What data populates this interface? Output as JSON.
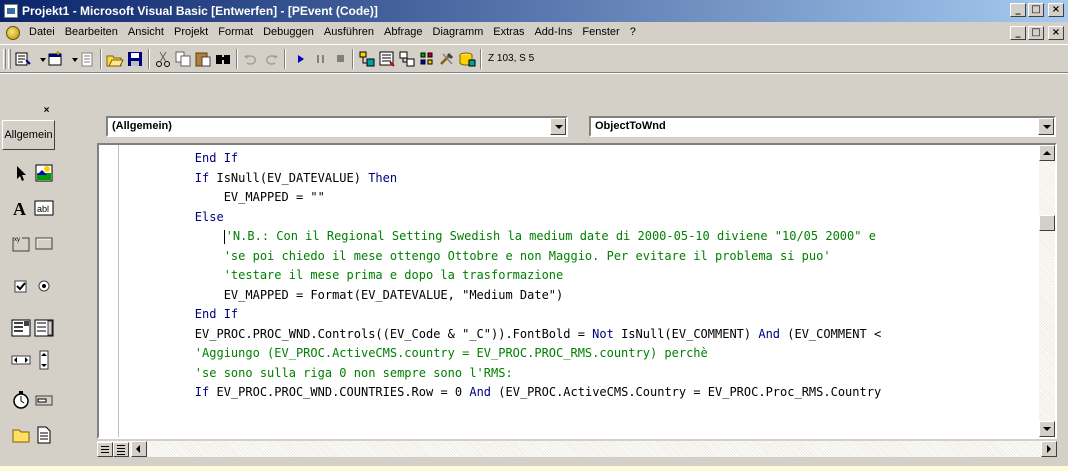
{
  "window": {
    "title": "Projekt1 - Microsoft Visual Basic [Entwerfen] - [PEvent (Code)]",
    "minimize": "_",
    "maximize": "□",
    "close": "×"
  },
  "menu": {
    "items": [
      "Datei",
      "Bearbeiten",
      "Ansicht",
      "Projekt",
      "Format",
      "Debuggen",
      "Ausführen",
      "Abfrage",
      "Diagramm",
      "Extras",
      "Add-Ins",
      "Fenster",
      "?"
    ],
    "restore": "_",
    "restore2": "□",
    "close": "×"
  },
  "toolbar": {
    "position": "Z 103, S 5",
    "icons": [
      "add-project-icon",
      "add-form-icon",
      "menu-editor-icon",
      "open-icon",
      "save-icon",
      "cut-icon",
      "copy-icon",
      "paste-icon",
      "find-icon",
      "undo-icon",
      "redo-icon",
      "run-icon",
      "break-icon",
      "stop-icon",
      "project-explorer-icon",
      "properties-icon",
      "form-layout-icon",
      "object-browser-icon",
      "toolbox-icon",
      "data-view-icon"
    ]
  },
  "toolbox": {
    "close": "×",
    "tab": "Allgemein",
    "tools": [
      "pointer-icon",
      "picturebox-icon",
      "label-icon",
      "textbox-icon",
      "frame-icon",
      "commandbutton-icon",
      "checkbox-icon",
      "optionbutton-icon",
      "combobox-icon",
      "listbox-icon",
      "hscrollbar-icon",
      "vscrollbar-icon",
      "timer-icon",
      "drivelistbox-icon",
      "dirlistbox-icon",
      "filelistbox-icon"
    ]
  },
  "code_window": {
    "object_combo": "(Allgemein)",
    "procedure_combo": "ObjectToWnd",
    "lines": [
      [
        {
          "t": "        End If",
          "c": "kw"
        }
      ],
      [
        {
          "t": "        If ",
          "c": "kw"
        },
        {
          "t": "IsNull(EV_DATEVALUE) ",
          "c": ""
        },
        {
          "t": "Then",
          "c": "kw"
        }
      ],
      [
        {
          "t": "            EV_MAPPED = \"\"",
          "c": ""
        }
      ],
      [
        {
          "t": "        Else",
          "c": "kw"
        }
      ],
      [
        {
          "t": "            'N.B.: Con il Regional Setting Swedish la medium date di 2000-05-10 diviene \"10/05 2000\" e",
          "c": "cm",
          "cursor": true
        }
      ],
      [
        {
          "t": "            'se poi chiedo il mese ottengo Ottobre e non Maggio. Per evitare il problema si puo'",
          "c": "cm"
        }
      ],
      [
        {
          "t": "            'testare il mese prima e dopo la trasformazione",
          "c": "cm"
        }
      ],
      [
        {
          "t": "            EV_MAPPED = Format(EV_DATEVALUE, \"Medium Date\")",
          "c": ""
        }
      ],
      [
        {
          "t": "        End If",
          "c": "kw"
        }
      ],
      [
        {
          "t": "        EV_PROC.PROC_WND.Controls((EV_Code & \"_C\")).FontBold = ",
          "c": ""
        },
        {
          "t": "Not",
          "c": "kw"
        },
        {
          "t": " IsNull(EV_COMMENT) ",
          "c": ""
        },
        {
          "t": "And",
          "c": "kw"
        },
        {
          "t": " (EV_COMMENT <",
          "c": ""
        }
      ],
      [
        {
          "t": "        'Aggiungo (EV_PROC.ActiveCMS.country = EV_PROC.PROC_RMS.country) perchè",
          "c": "cm"
        }
      ],
      [
        {
          "t": "        'se sono sulla riga 0 non sempre sono l'RMS:",
          "c": "cm"
        }
      ],
      [
        {
          "t": "        If ",
          "c": "kw"
        },
        {
          "t": "EV_PROC.PROC_WND.COUNTRIES.Row = 0 ",
          "c": ""
        },
        {
          "t": "And",
          "c": "kw"
        },
        {
          "t": " (EV_PROC.ActiveCMS.Country = EV_PROC.Proc_RMS.Country",
          "c": ""
        }
      ]
    ]
  }
}
